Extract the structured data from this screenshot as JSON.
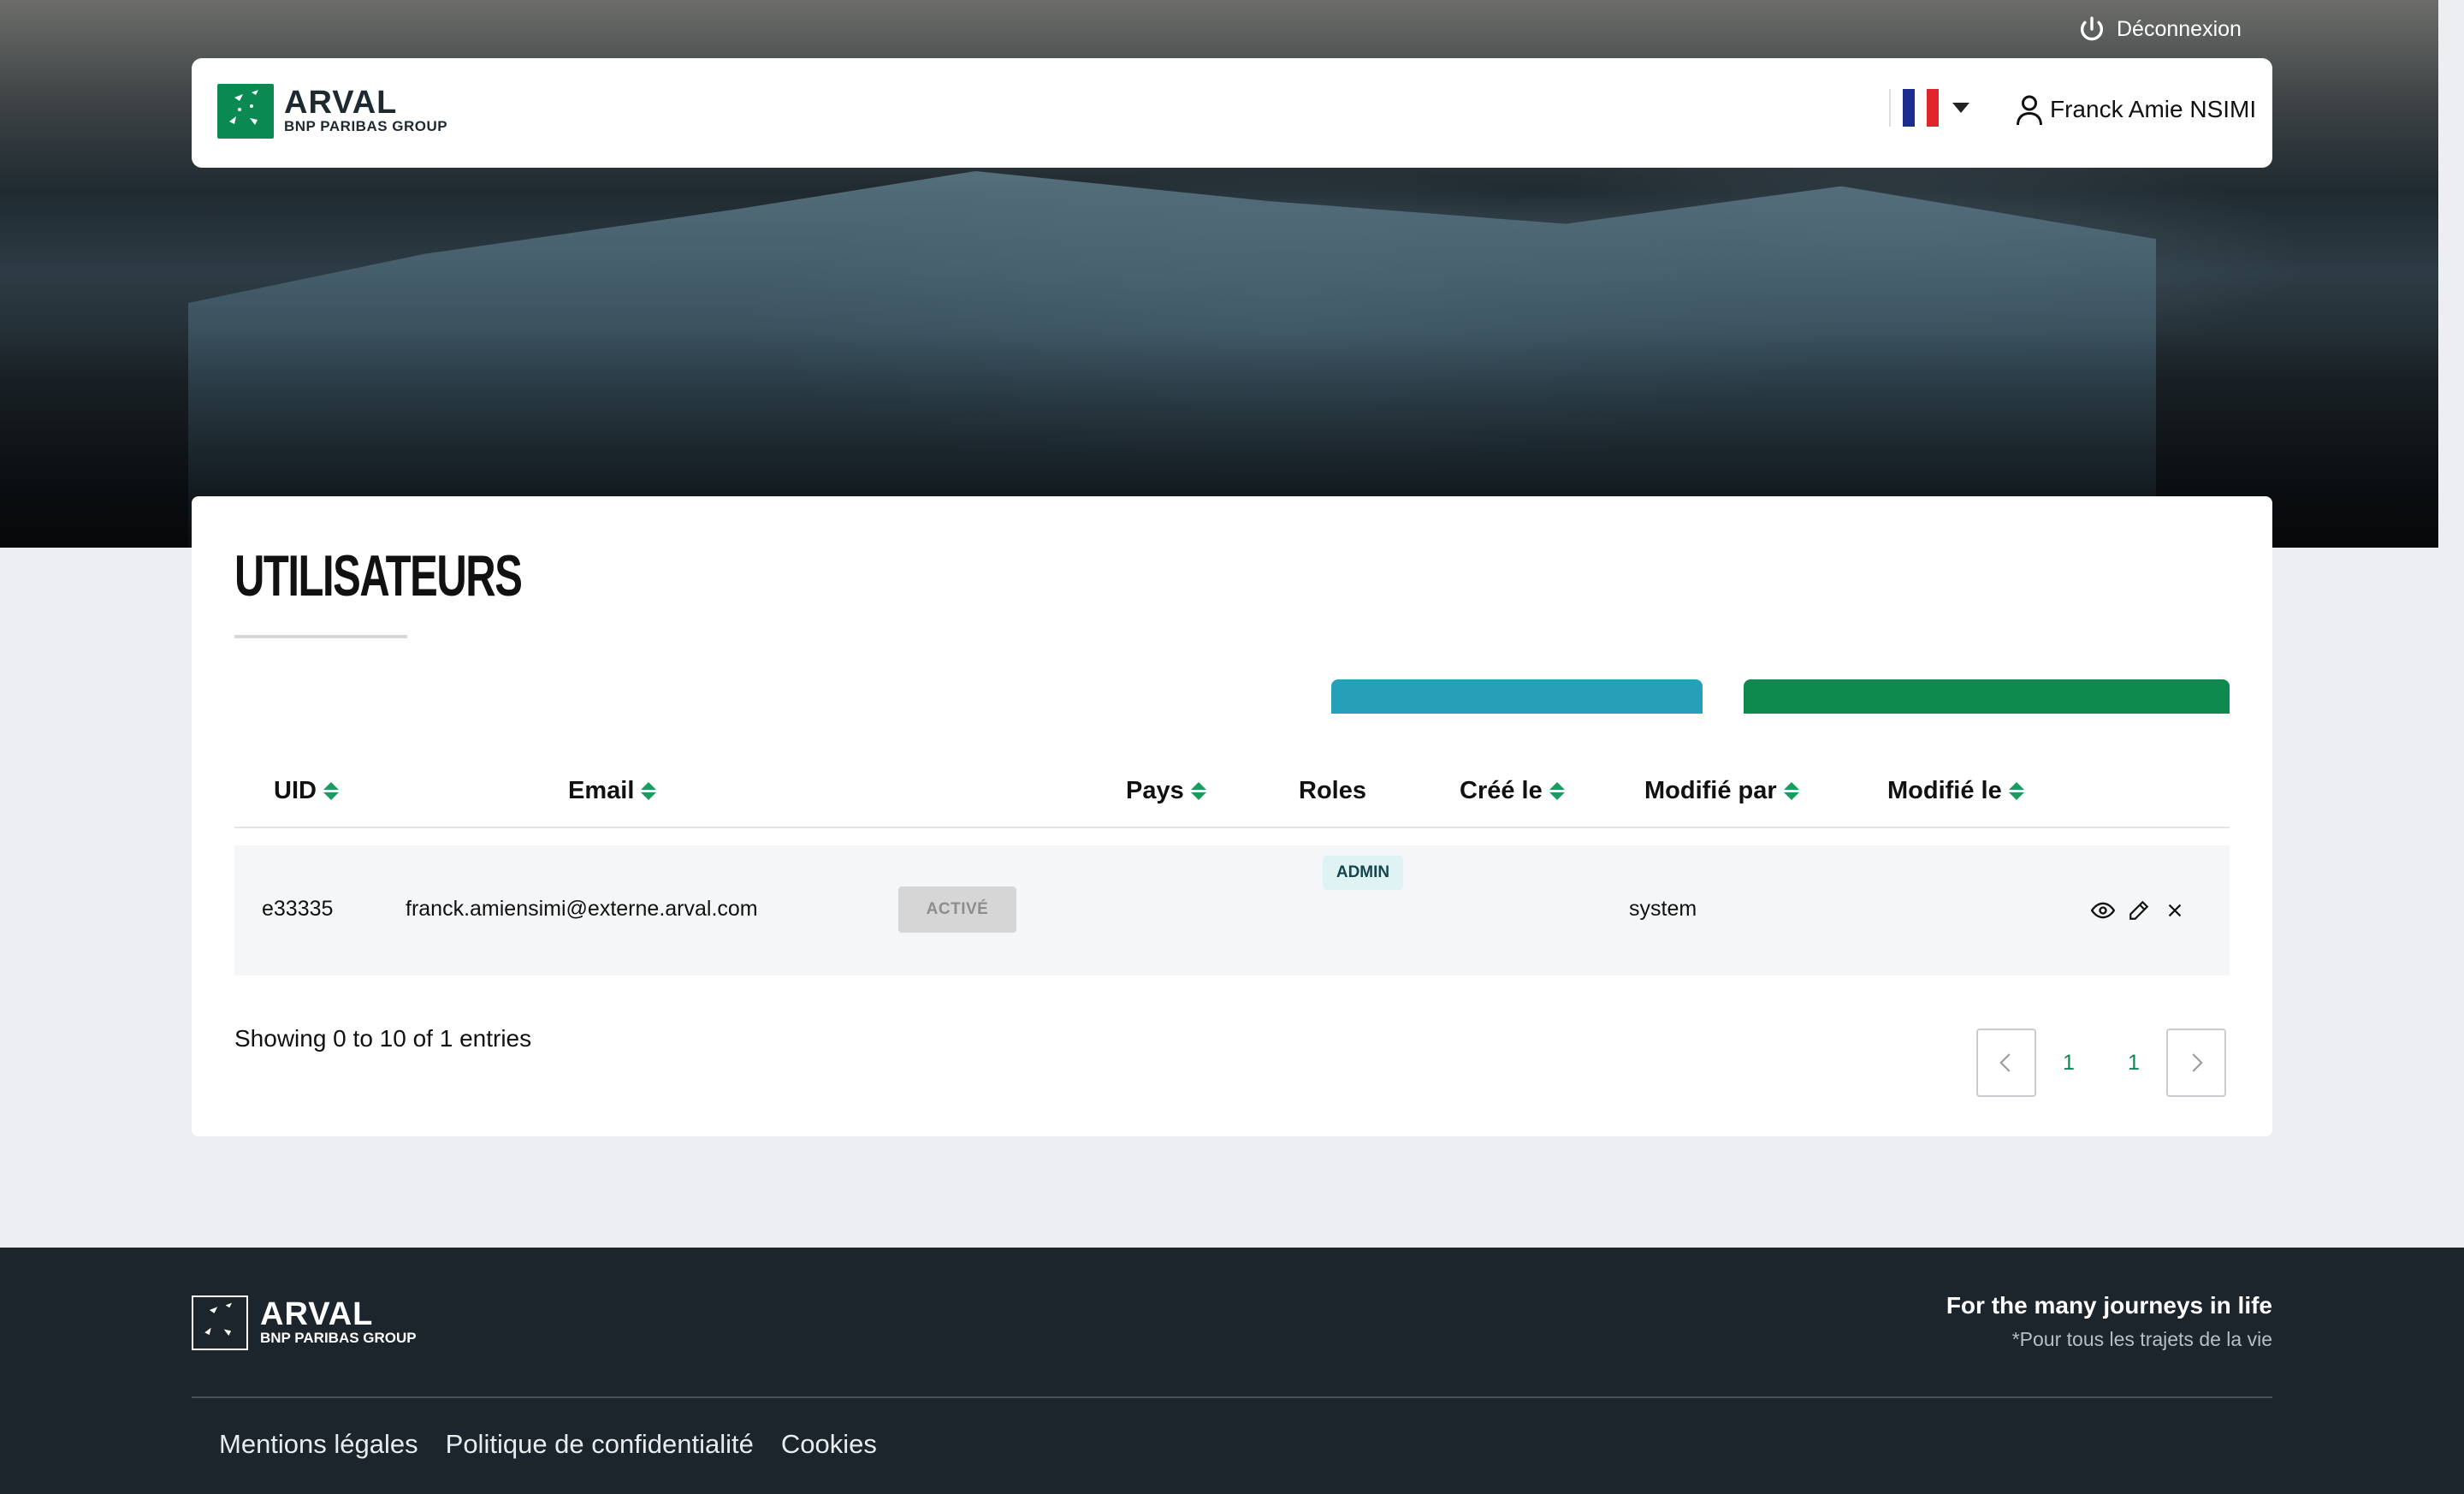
{
  "topbar": {
    "logout_label": "Déconnexion"
  },
  "header": {
    "logo": {
      "brand": "ARVAL",
      "group": "BNP PARIBAS GROUP"
    },
    "language": {
      "selected": "FR"
    },
    "user_name": "Franck Amie NSIMI"
  },
  "page": {
    "title": "UTILISATEURS"
  },
  "table": {
    "columns": [
      "UID",
      "Email",
      "Pays",
      "Roles",
      "Créé le",
      "Modifié par",
      "Modifié le"
    ],
    "rows": [
      {
        "uid": "e33335",
        "email": "franck.amiensimi@externe.arval.com",
        "status": "ACTIVÉ",
        "pays": "",
        "role": "ADMIN",
        "created": "",
        "modified_by": "system",
        "modified_on": ""
      }
    ]
  },
  "pagination": {
    "info": "Showing 0 to 10 of 1 entries",
    "pages": [
      "1",
      "1"
    ]
  },
  "footer": {
    "logo": {
      "brand": "ARVAL",
      "group": "BNP PARIBAS GROUP"
    },
    "tagline": "For the many journeys in life",
    "tagline_sub": "*Pour tous les trajets de la vie",
    "links": [
      "Mentions légales",
      "Politique de confidentialité",
      "Cookies"
    ]
  },
  "colors": {
    "brand_green": "#0a8a52",
    "button_blue": "#26a0b8",
    "button_green": "#0e8a4f",
    "footer_bg": "#1b252b",
    "page_bg": "#edeef1"
  },
  "icons": [
    "power-icon",
    "user-icon",
    "flag-fr-icon",
    "chevron-down-icon",
    "sort-icon",
    "eye-icon",
    "pencil-icon",
    "close-icon",
    "chevron-left-icon",
    "chevron-right-icon"
  ]
}
